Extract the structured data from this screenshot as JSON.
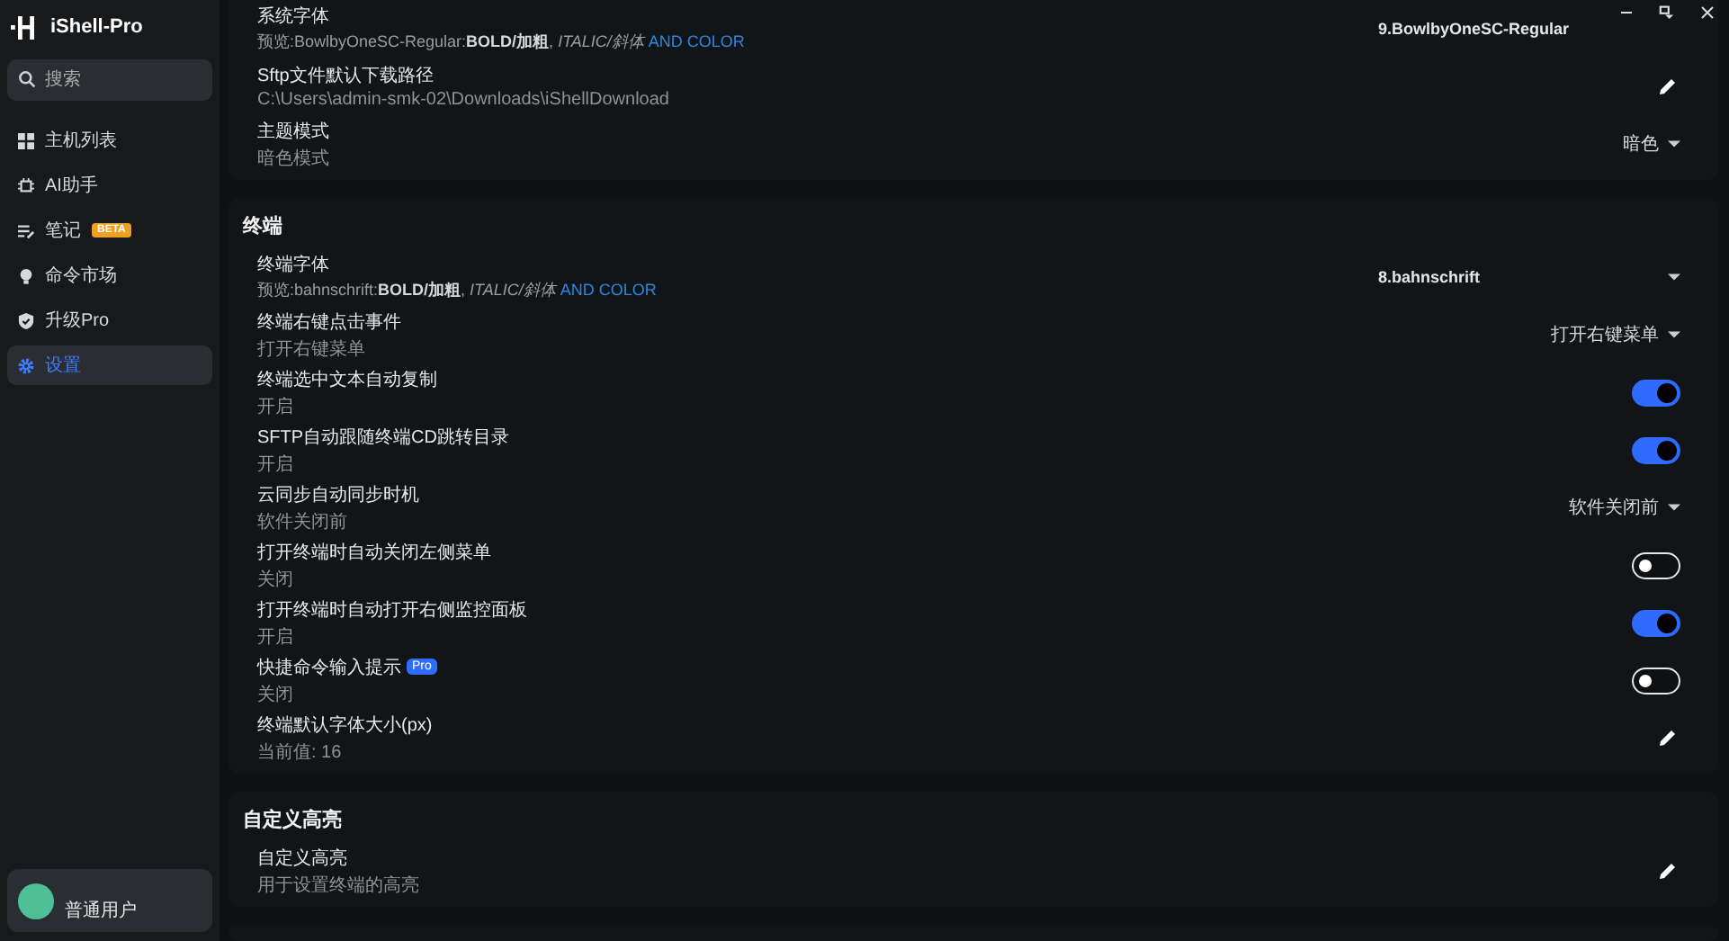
{
  "sidebar": {
    "app_name": "iShell-Pro",
    "search": {
      "placeholder": "搜索"
    },
    "items": [
      {
        "label": "主机列表",
        "selected": false
      },
      {
        "label": "AI助手",
        "selected": false
      },
      {
        "label": "笔记",
        "badge": "BETA",
        "selected": false
      },
      {
        "label": "命令市场",
        "selected": false
      },
      {
        "label": "升级Pro",
        "selected": false
      },
      {
        "label": "设置",
        "selected": true
      }
    ],
    "user": {
      "name": "普通用户"
    }
  },
  "sections": [
    {
      "rows": [
        {
          "title": "系统字体",
          "preview": "预览:BowlbyOneSC-Regular:**BOLD/加粗**, *ITALIC/斜体*",
          "accent": "AND COLOR",
          "control": {
            "kind": "font",
            "value": "9.BowlbyOneSC-Regular",
            "caret": false
          }
        },
        {
          "title": "Sftp文件默认下载路径",
          "subtitle": "C:\\Users\\admin-smk-02\\Downloads\\iShellDownload",
          "control": {
            "kind": "edit"
          }
        },
        {
          "title": "主题模式",
          "subtitle": "暗色模式",
          "control": {
            "kind": "select",
            "value": "暗色"
          }
        }
      ]
    },
    {
      "title": "终端",
      "rows": [
        {
          "title": "终端字体",
          "preview": "预览:bahnschrift:**BOLD/加粗**, *ITALIC/斜体*",
          "accent": "AND COLOR",
          "control": {
            "kind": "font",
            "value": "8.bahnschrift",
            "caret": true
          }
        },
        {
          "title": "终端右键点击事件",
          "subtitle": "打开右键菜单",
          "control": {
            "kind": "select",
            "value": "打开右键菜单"
          }
        },
        {
          "title": "终端选中文本自动复制",
          "subtitle": "开启",
          "control": {
            "kind": "toggle",
            "on": true
          }
        },
        {
          "title": "SFTP自动跟随终端CD跳转目录",
          "subtitle": "开启",
          "control": {
            "kind": "toggle",
            "on": true
          }
        },
        {
          "title": "云同步自动同步时机",
          "subtitle": "软件关闭前",
          "control": {
            "kind": "select",
            "value": "软件关闭前"
          }
        },
        {
          "title": "打开终端时自动关闭左侧菜单",
          "subtitle": "关闭",
          "control": {
            "kind": "toggle",
            "on": false
          }
        },
        {
          "title": "打开终端时自动打开右侧监控面板",
          "subtitle": "开启",
          "control": {
            "kind": "toggle",
            "on": true
          }
        },
        {
          "title": "快捷命令输入提示",
          "badge": "Pro",
          "subtitle": "关闭",
          "control": {
            "kind": "toggle",
            "on": false
          }
        },
        {
          "title": "终端默认字体大小(px)",
          "subtitle": "当前值: 16",
          "control": {
            "kind": "edit"
          }
        }
      ]
    },
    {
      "title": "自定义高亮",
      "rows": [
        {
          "title": "自定义高亮",
          "subtitle": "用于设置终端的高亮",
          "control": {
            "kind": "edit"
          }
        }
      ]
    }
  ]
}
